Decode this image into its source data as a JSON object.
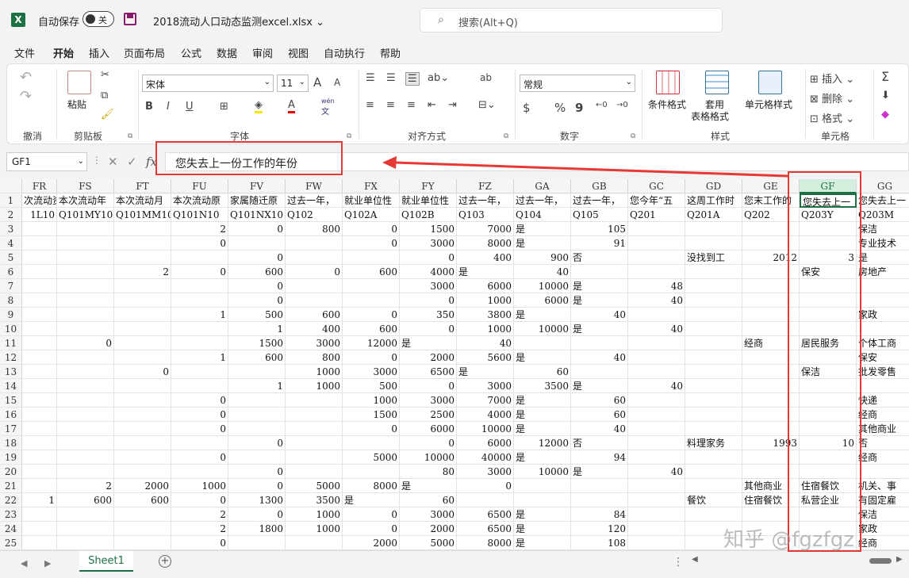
{
  "titlebar": {
    "logo": "X",
    "autosave_label": "自动保存",
    "autosave_state": "关",
    "filename": "2018流动人口动态监测excel.xlsx",
    "search_placeholder": "搜索(Alt+Q)",
    "search_icon": "search-icon"
  },
  "menu": [
    "文件",
    "开始",
    "插入",
    "页面布局",
    "公式",
    "数据",
    "审阅",
    "视图",
    "自动执行",
    "帮助"
  ],
  "menu_active": "开始",
  "ribbon": {
    "groups": [
      "撤消",
      "剪贴板",
      "字体",
      "对齐方式",
      "数字",
      "样式",
      "单元格"
    ],
    "paste_label": "粘贴",
    "font_name": "宋体",
    "font_size": "11",
    "font_grow": "A",
    "font_shrink": "A",
    "bold": "B",
    "italic": "I",
    "underline": "U",
    "font_color_glyph": "A",
    "phonetic_top": "wén",
    "phonetic_bottom": "文",
    "wrap_glyph": "ab",
    "number_format": "常规",
    "currency": "$",
    "percent": "%",
    "comma": "9",
    "conditional_format": "条件格式",
    "table_format_1": "套用",
    "table_format_2": "表格格式",
    "cell_styles": "单元格样式",
    "insert": "插入",
    "delete": "删除",
    "format": "格式",
    "sum_glyph": "Σ"
  },
  "formula_bar": {
    "name_box": "GF1",
    "fx": "fx",
    "value": "您失去上一份工作的年份"
  },
  "columns": [
    "FR",
    "FS",
    "FT",
    "FU",
    "FV",
    "FW",
    "FX",
    "FY",
    "FZ",
    "GA",
    "GB",
    "GC",
    "GD",
    "GE",
    "GF",
    "GG"
  ],
  "selected_column": "GF",
  "rows": [
    [
      "次流动资",
      "本次流动年",
      "本次流动月",
      "本次流动原",
      "家属随迁原",
      "过去一年，",
      "就业单位性",
      "就业单位性",
      "过去一年，",
      "过去一年，",
      "过去一年，",
      "您今年“五",
      "这周工作时",
      "您末工作的",
      "您失去上一",
      "您失去上一"
    ],
    [
      "1L10",
      "Q101MY10",
      "Q101MM10",
      "Q101N10",
      "Q101NX10",
      "Q102",
      "Q102A",
      "Q102B",
      "Q103",
      "Q104",
      "Q105",
      "Q201",
      "Q201A",
      "Q202",
      "Q203Y",
      "Q203M"
    ],
    [
      "",
      "",
      "",
      "2",
      "0",
      "800",
      "0",
      "1500",
      "7000",
      "是",
      "105",
      "",
      "",
      "",
      "",
      "保洁"
    ],
    [
      "",
      "",
      "",
      "0",
      "",
      "",
      "0",
      "3000",
      "8000",
      "是",
      "91",
      "",
      "",
      "",
      "",
      "专业技术"
    ],
    [
      "",
      "",
      "",
      "",
      "0",
      "",
      "",
      "0",
      "400",
      "900",
      "否",
      "",
      "没找到工",
      "2012",
      "3",
      "是"
    ],
    [
      "",
      "",
      "2",
      "0",
      "600",
      "0",
      "600",
      "4000",
      "是",
      "40",
      "",
      "",
      "",
      "",
      "保安",
      "房地产"
    ],
    [
      "",
      "",
      "",
      "",
      "0",
      "",
      "",
      "3000",
      "6000",
      "10000",
      "是",
      "48",
      "",
      "",
      "",
      ""
    ],
    [
      "",
      "",
      "",
      "",
      "0",
      "",
      "",
      "0",
      "1000",
      "6000",
      "是",
      "40",
      "",
      "",
      "",
      ""
    ],
    [
      "",
      "",
      "",
      "1",
      "500",
      "600",
      "0",
      "350",
      "3800",
      "是",
      "40",
      "",
      "",
      "",
      "",
      "家政"
    ],
    [
      "",
      "",
      "",
      "",
      "1",
      "400",
      "600",
      "0",
      "1000",
      "10000",
      "是",
      "40",
      "",
      "",
      "",
      ""
    ],
    [
      "",
      "0",
      "",
      "",
      "1500",
      "3000",
      "12000",
      "是",
      "40",
      "",
      "",
      "",
      "",
      "经商",
      "居民服务",
      "个体工商"
    ],
    [
      "",
      "",
      "",
      "1",
      "600",
      "800",
      "0",
      "2000",
      "5600",
      "是",
      "40",
      "",
      "",
      "",
      "",
      "保安"
    ],
    [
      "",
      "",
      "0",
      "",
      "",
      "1000",
      "3000",
      "6500",
      "是",
      "60",
      "",
      "",
      "",
      "",
      "保洁",
      "批发零售"
    ],
    [
      "",
      "",
      "",
      "",
      "1",
      "1000",
      "500",
      "0",
      "3000",
      "3500",
      "是",
      "40",
      "",
      "",
      "",
      ""
    ],
    [
      "",
      "",
      "",
      "0",
      "",
      "",
      "1000",
      "3000",
      "7000",
      "是",
      "60",
      "",
      "",
      "",
      "",
      "快递"
    ],
    [
      "",
      "",
      "",
      "0",
      "",
      "",
      "1500",
      "2500",
      "4000",
      "是",
      "60",
      "",
      "",
      "",
      "",
      "经商"
    ],
    [
      "",
      "",
      "",
      "0",
      "",
      "",
      "0",
      "6000",
      "10000",
      "是",
      "40",
      "",
      "",
      "",
      "",
      "其他商业"
    ],
    [
      "",
      "",
      "",
      "",
      "0",
      "",
      "",
      "0",
      "6000",
      "12000",
      "否",
      "",
      "料理家务",
      "1993",
      "10",
      "否"
    ],
    [
      "",
      "",
      "",
      "0",
      "",
      "",
      "5000",
      "10000",
      "40000",
      "是",
      "94",
      "",
      "",
      "",
      "",
      "经商"
    ],
    [
      "",
      "",
      "",
      "",
      "0",
      "",
      "",
      "80",
      "3000",
      "10000",
      "是",
      "40",
      "",
      "",
      "",
      ""
    ],
    [
      "",
      "2",
      "2000",
      "1000",
      "0",
      "5000",
      "8000",
      "是",
      "0",
      "",
      "",
      "",
      "",
      "其他商业",
      "住宿餐饮",
      "机关、事"
    ],
    [
      "1",
      "600",
      "600",
      "0",
      "1300",
      "3500",
      "是",
      "60",
      "",
      "",
      "",
      "",
      "餐饮",
      "住宿餐饮",
      "私营企业",
      "有固定雇"
    ],
    [
      "",
      "",
      "",
      "2",
      "0",
      "1000",
      "0",
      "3000",
      "6500",
      "是",
      "84",
      "",
      "",
      "",
      "",
      "保洁"
    ],
    [
      "",
      "",
      "",
      "2",
      "1800",
      "1000",
      "0",
      "2000",
      "6500",
      "是",
      "120",
      "",
      "",
      "",
      "",
      "家政"
    ],
    [
      "",
      "",
      "",
      "0",
      "",
      "",
      "2000",
      "5000",
      "8000",
      "是",
      "108",
      "",
      "",
      "",
      "",
      "经商"
    ]
  ],
  "sheet_tab": "Sheet1",
  "add_sheet": "+",
  "more_glyph": "⋮",
  "watermark": "知乎 @fgzfgz",
  "annotation_color": "#e53935",
  "accent_color": "#1e7145"
}
